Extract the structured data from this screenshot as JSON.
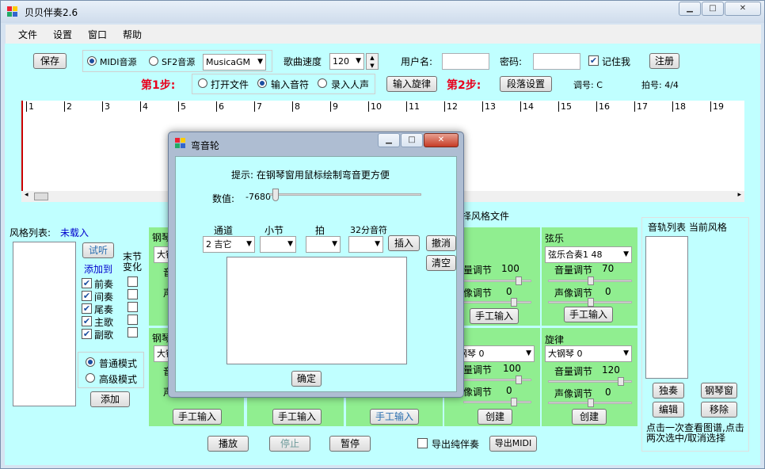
{
  "window": {
    "title": "贝贝伴奏2.6"
  },
  "menu": [
    "文件",
    "设置",
    "窗口",
    "帮助"
  ],
  "toolbar": {
    "save": "保存",
    "midi_source": "MIDI音源",
    "sf2_source": "SF2音源",
    "soundfont": "MusicaGM",
    "tempo_label": "歌曲速度",
    "tempo_value": "120",
    "username_label": "用户名:",
    "password_label": "密码:",
    "remember_label": "记住我",
    "register": "注册"
  },
  "steps": {
    "step1": "第1步:",
    "open_file": "打开文件",
    "input_notes": "输入音符",
    "record_voice": "录入人声",
    "input_melody": "输入旋律",
    "step2": "第2步:",
    "section_settings": "段落设置",
    "key_label": "调号: C",
    "meter_label": "拍号: 4/4"
  },
  "ruler_ticks": [
    "1",
    "2",
    "3",
    "4",
    "5",
    "6",
    "7",
    "8",
    "9",
    "10",
    "11",
    "12",
    "13",
    "14",
    "15",
    "16",
    "17",
    "18",
    "19"
  ],
  "style_list": {
    "label": "风格列表:",
    "status": "未载入",
    "preview": "试听",
    "add_to": "添加到",
    "bar_change": "末节变化",
    "checks": [
      "前奏",
      "间奏",
      "尾奏",
      "主歌",
      "副歌"
    ],
    "normal_mode": "普通模式",
    "advanced_mode": "高级模式",
    "add": "添加"
  },
  "style_file_caption": "择风格文件",
  "panels": {
    "strings_title": "弦乐",
    "strings_instrument": "弦乐合奏1 48",
    "volume_label": "音量调节",
    "strings_volume": "70",
    "pan_label": "声像调节",
    "strings_pan": "0",
    "manual_input": "手工输入",
    "melody_title": "旋律",
    "melody_instrument": "大钢琴 0",
    "melody_volume": "120",
    "melody_pan": "0",
    "create": "创建",
    "mid_volume_top": "100",
    "mid_pan_top": "0",
    "mid_instrument_bottom": "钢琴 0",
    "mid_volume_bottom": "100",
    "mid_pan_bottom": "0",
    "left_title_top": "钢琴",
    "left_title_bottom": "钢琴",
    "left_combo_top": "大钢",
    "left_combo_bottom": "大钢",
    "cut_vol": "音",
    "cut_pan": "声",
    "cut_vol_mid": "量调节",
    "cut_pan_mid": "像调节"
  },
  "track_list": {
    "label": "音轨列表 当前风格",
    "solo": "独奏",
    "piano_window": "钢琴窗",
    "edit": "编辑",
    "remove": "移除",
    "hint": "点击一次查看图谱,点击两次选中/取消选择"
  },
  "bottom": {
    "play": "播放",
    "stop": "停止",
    "pause": "暂停",
    "export_pure": "导出纯伴奏",
    "export_midi": "导出MIDI"
  },
  "dialog": {
    "title": "弯音轮",
    "hint": "提示: 在钢琴窗用鼠标绘制弯音更方便",
    "value_label": "数值:",
    "value": "-7680",
    "channel_label": "通道",
    "bar_label": "小节",
    "beat_label": "拍",
    "note32_label": "32分音符",
    "channel_value": "2 吉它",
    "insert": "插入",
    "undo": "撤消",
    "clear": "清空",
    "ok": "确定",
    "slider_level": 0.02
  },
  "colors": {
    "client_bg": "#c0ffff",
    "panel_green": "#90ee90",
    "step_red": "#e8001c"
  }
}
